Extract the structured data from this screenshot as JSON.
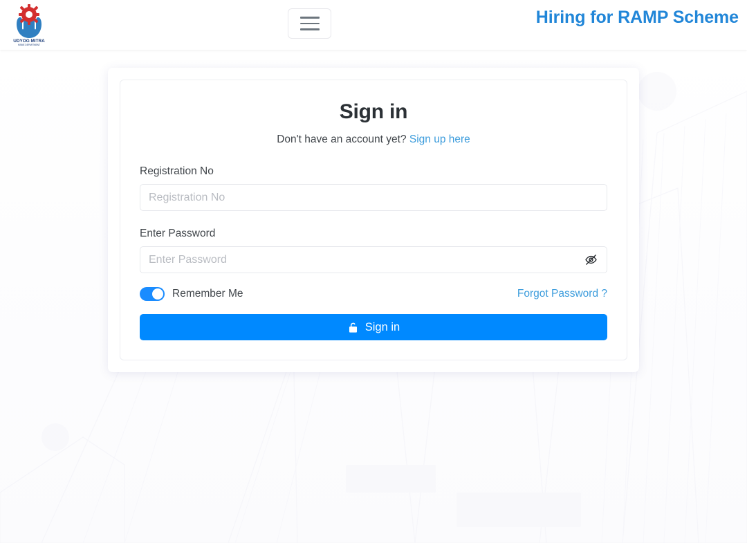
{
  "header": {
    "logo_alt": "Udyog Mitra",
    "logo_text_main": "UDYOG MITRA",
    "logo_text_sub": "MSME DEPARTMENT",
    "menu_toggle_label": "Toggle navigation",
    "title": "Hiring for RAMP Scheme",
    "title_color": "#2186d8"
  },
  "signin": {
    "heading": "Sign in",
    "signup_prompt": "Don't have an account yet?",
    "signup_link": "Sign up here",
    "registration": {
      "label": "Registration No",
      "placeholder": "Registration No",
      "value": ""
    },
    "password": {
      "label": "Enter Password",
      "placeholder": "Enter Password",
      "value": "",
      "toggle_icon": "eye-off-icon"
    },
    "remember": {
      "label": "Remember Me",
      "checked": "true"
    },
    "forgot_link": "Forgot Password ?",
    "submit": {
      "label": "Sign in",
      "icon": "unlock-icon",
      "color": "#0089ff"
    }
  }
}
